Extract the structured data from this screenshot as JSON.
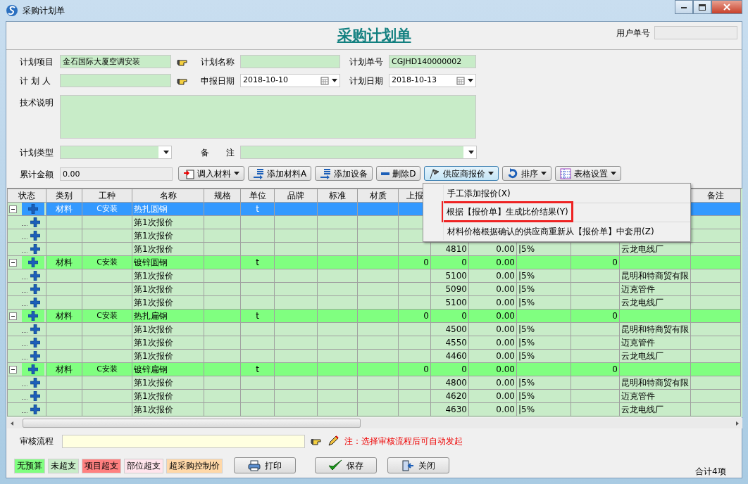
{
  "window": {
    "title": "采购计划单"
  },
  "header": {
    "title": "采购计划单",
    "user_no_label": "用户单号"
  },
  "form": {
    "project": {
      "label": "计划项目",
      "value": "金石国际大厦空调安装"
    },
    "plan_name": {
      "label": "计划名称"
    },
    "plan_no": {
      "label": "计划单号",
      "value": "CGJHD140000002"
    },
    "planner": {
      "label": "计 划 人"
    },
    "report_date": {
      "label": "申报日期",
      "value": "2018-10-10"
    },
    "plan_date": {
      "label": "计划日期",
      "value": "2018-10-13"
    },
    "tech_notes": {
      "label": "技术说明"
    },
    "plan_type": {
      "label": "计划类型"
    },
    "remarks": {
      "label": "备　　注"
    },
    "total": {
      "label": "累计金额",
      "value": "0.00"
    }
  },
  "toolbar": [
    {
      "label": "调入材料",
      "kind": "import",
      "dropdown": true,
      "pressed": false
    },
    {
      "label": "添加材料A",
      "kind": "add",
      "dropdown": false,
      "pressed": false
    },
    {
      "label": "添加设备",
      "kind": "add",
      "dropdown": false,
      "pressed": false
    },
    {
      "label": "删除D",
      "kind": "delete",
      "dropdown": false,
      "pressed": false
    },
    {
      "label": "供应商报价",
      "kind": "quote",
      "dropdown": true,
      "pressed": true
    },
    {
      "label": "排序",
      "kind": "sort",
      "dropdown": true,
      "pressed": false
    },
    {
      "label": "表格设置",
      "kind": "grid",
      "dropdown": true,
      "pressed": false
    }
  ],
  "table": {
    "columns": [
      {
        "label": "状态"
      },
      {
        "label": "类别"
      },
      {
        "label": "工种"
      },
      {
        "label": "名称"
      },
      {
        "label": "规格"
      },
      {
        "label": "单位"
      },
      {
        "label": "品牌"
      },
      {
        "label": "标准"
      },
      {
        "label": "材质"
      },
      {
        "label": "上报"
      },
      {
        "label": "备注"
      }
    ],
    "rows": [
      {
        "kind": "group",
        "expanded": true,
        "selected": true,
        "category": "材料",
        "trade": "C安装",
        "name": "热扎圆钢",
        "unit": "t",
        "children": [
          {
            "kind": "quote",
            "selected": false,
            "name": "第1次报价"
          },
          {
            "kind": "quote",
            "selected": false,
            "name": "第1次报价"
          },
          {
            "kind": "quote",
            "selected": false,
            "name": "第1次报价",
            "column_11": "4810",
            "column_12": "0.00",
            "column_13": "|5%",
            "column_15": "云龙电线厂"
          }
        ]
      },
      {
        "kind": "group",
        "expanded": true,
        "selected": false,
        "category": "材料",
        "trade": "C安装",
        "name": "镀锌圆钢",
        "unit": "t",
        "reported": "0",
        "column_11": "0",
        "column_12": "0.00",
        "column_14": "0",
        "children": [
          {
            "kind": "quote",
            "selected": false,
            "name": "第1次报价",
            "column_11": "5100",
            "column_12": "0.00",
            "column_13": "|5%",
            "column_15": "昆明和特商贸有限"
          },
          {
            "kind": "quote",
            "selected": false,
            "name": "第1次报价",
            "column_11": "5090",
            "column_12": "0.00",
            "column_13": "|5%",
            "column_15": "迈克管件"
          },
          {
            "kind": "quote",
            "selected": false,
            "name": "第1次报价",
            "column_11": "5100",
            "column_12": "0.00",
            "column_13": "|5%",
            "column_15": "云龙电线厂"
          }
        ]
      },
      {
        "kind": "group",
        "expanded": true,
        "selected": false,
        "category": "材料",
        "trade": "C安装",
        "name": "热扎扁钢",
        "unit": "t",
        "reported": "0",
        "column_11": "0",
        "column_12": "0.00",
        "column_14": "0",
        "children": [
          {
            "kind": "quote",
            "selected": false,
            "name": "第1次报价",
            "column_11": "4500",
            "column_12": "0.00",
            "column_13": "|5%",
            "column_15": "昆明和特商贸有限"
          },
          {
            "kind": "quote",
            "selected": false,
            "name": "第1次报价",
            "column_11": "4550",
            "column_12": "0.00",
            "column_13": "|5%",
            "column_15": "迈克管件"
          },
          {
            "kind": "quote",
            "selected": false,
            "name": "第1次报价",
            "column_11": "4460",
            "column_12": "0.00",
            "column_13": "|5%",
            "column_15": "云龙电线厂"
          }
        ]
      },
      {
        "kind": "group",
        "expanded": true,
        "selected": false,
        "category": "材料",
        "trade": "C安装",
        "name": "镀锌扁钢",
        "unit": "t",
        "reported": "0",
        "column_11": "0",
        "column_12": "0.00",
        "column_14": "0",
        "children": [
          {
            "kind": "quote",
            "selected": false,
            "name": "第1次报价",
            "column_11": "4800",
            "column_12": "0.00",
            "column_13": "|5%",
            "column_15": "昆明和特商贸有限"
          },
          {
            "kind": "quote",
            "selected": false,
            "name": "第1次报价",
            "column_11": "4620",
            "column_12": "0.00",
            "column_13": "|5%",
            "column_15": "迈克管件"
          },
          {
            "kind": "quote",
            "selected": false,
            "name": "第1次报价",
            "column_11": "4630",
            "column_12": "0.00",
            "column_13": "|5%",
            "column_15": "云龙电线厂"
          }
        ]
      }
    ]
  },
  "menu": {
    "items": [
      {
        "label": "手工添加报价(X)",
        "annotated": false
      },
      {
        "label": "根据【报价单】生成比价结果(Y)",
        "annotated": true
      },
      {
        "label": "材料价格根据确认的供应商重新从【报价单】中套用(Z)",
        "annotated": false
      }
    ]
  },
  "audit": {
    "label": "审核流程",
    "note": "注：选择审核流程后可自动发起"
  },
  "legend": [
    {
      "label": "无预算",
      "color": "#80ff80"
    },
    {
      "label": "未超支",
      "color": "#c8ecc8"
    },
    {
      "label": "项目超支",
      "color": "#ff8080"
    },
    {
      "label": "部位超支",
      "color": "#ffe4ec"
    },
    {
      "label": "超采购控制价",
      "color": "#ffd8a8"
    }
  ],
  "buttons": [
    {
      "label": "打印",
      "kind": "print"
    },
    {
      "label": "保存",
      "kind": "save"
    },
    {
      "label": "关闭",
      "kind": "close"
    }
  ],
  "status_bar": {
    "total": "合计4项"
  }
}
